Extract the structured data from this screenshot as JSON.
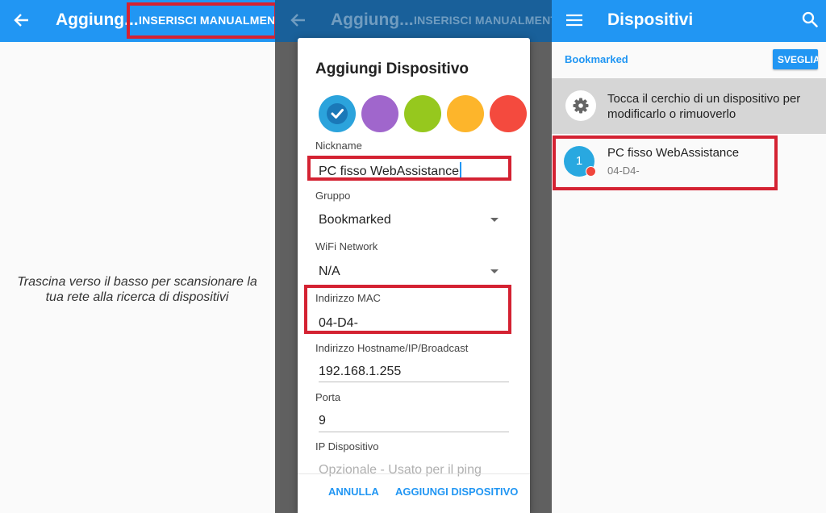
{
  "left_panel": {
    "title": "Aggiung...",
    "action_label": "INSERISCI MANUALMENTE",
    "hint": "Trascina verso il basso per scansionare la tua rete alla ricerca di dispositivi"
  },
  "middle_panel": {
    "title": "Aggiung...",
    "action_label": "INSERISCI MANUALMENTE",
    "dialog": {
      "title": "Aggiungi Dispositivo",
      "colors": [
        "#2ba3dc",
        "#a066cc",
        "#96c81e",
        "#fdb52b",
        "#f44a3e"
      ],
      "nickname": {
        "label": "Nickname",
        "value": "PC fisso WebAssistance"
      },
      "group": {
        "label": "Gruppo",
        "value": "Bookmarked"
      },
      "wifi": {
        "label": "WiFi Network",
        "value": "N/A"
      },
      "mac": {
        "label": "Indirizzo MAC",
        "value": "04-D4-"
      },
      "host": {
        "label": "Indirizzo Hostname/IP/Broadcast",
        "value": "192.168.1.255"
      },
      "port": {
        "label": "Porta",
        "value": "9"
      },
      "ip": {
        "label": "IP Dispositivo",
        "placeholder": "Opzionale - Usato per il ping"
      },
      "cancel_label": "ANNULLA",
      "add_label": "AGGIUNGI DISPOSITIVO"
    }
  },
  "right_panel": {
    "title": "Dispositivi",
    "section": "Bookmarked",
    "wake_label": "SVEGLIA",
    "info": "Tocca il cerchio di un dispositivo per modificarlo o rimuoverlo",
    "device": {
      "number": "1",
      "name": "PC fisso WebAssistance",
      "mac": "04-D4-"
    }
  },
  "colors": {
    "primary": "#2196f3",
    "highlight": "#d42232",
    "status_red": "#f0463c"
  }
}
